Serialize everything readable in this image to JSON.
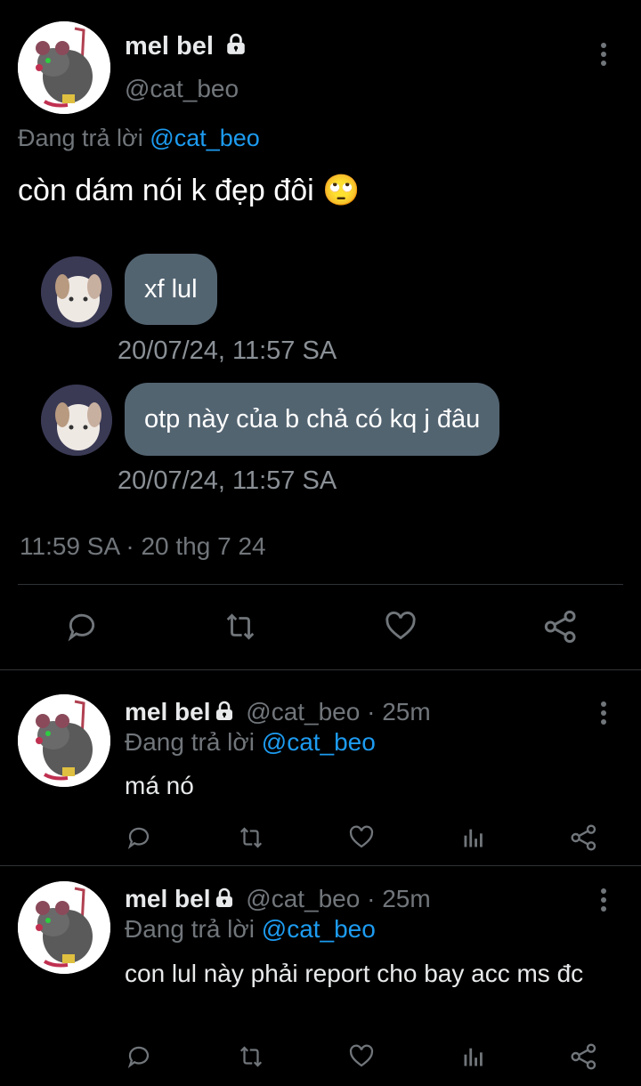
{
  "main_tweet": {
    "display_name": "mel bel",
    "handle": "@cat_beo",
    "replying_prefix": "Đang trả lời",
    "replying_to": "@cat_beo",
    "text": "còn dám nói k đẹp đôi 🙄",
    "timestamp": "11:59 SA · 20 thg 7 24"
  },
  "chat_messages": [
    {
      "text": "xf lul",
      "time": "20/07/24, 11:57 SA"
    },
    {
      "text": "otp này của b chả có kq j đâu",
      "time": "20/07/24, 11:57 SA"
    }
  ],
  "replies": [
    {
      "display_name": "mel bel",
      "meta": "@cat_beo · 25m",
      "replying_prefix": "Đang trả lời",
      "replying_to": "@cat_beo",
      "text": "má nó"
    },
    {
      "display_name": "mel bel",
      "meta": "@cat_beo · 25m",
      "replying_prefix": "Đang trả lời",
      "replying_to": "@cat_beo",
      "text": "con lul này phải report cho bay acc ms đc"
    }
  ],
  "icons": [
    "lock-icon",
    "more-icon",
    "reply-icon",
    "retweet-icon",
    "like-icon",
    "share-icon",
    "views-icon"
  ]
}
